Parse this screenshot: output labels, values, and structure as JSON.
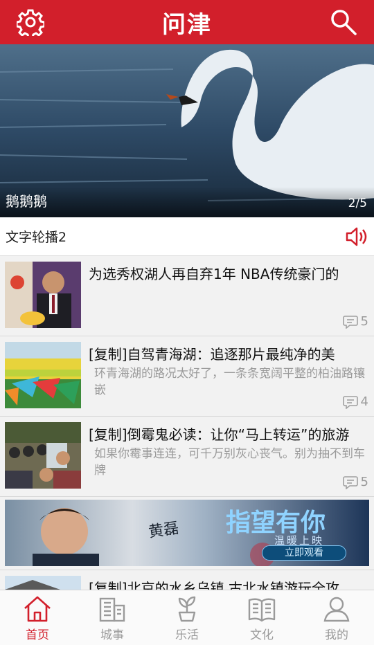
{
  "header": {
    "title": "问津",
    "settings_icon": "gear-icon",
    "search_icon": "search-icon",
    "bg_color": "#d21f2b"
  },
  "banner": {
    "caption": "鹅鹅鹅",
    "counter": "2/5"
  },
  "ticker": {
    "text": "文字轮播2",
    "icon": "speaker-icon"
  },
  "news": [
    {
      "headline": "为选秀权湖人再自弃1年 NBA传统豪门的",
      "summary": "",
      "comments": "5"
    },
    {
      "headline": "[复制]自驾青海湖：追逐那片最纯净的美",
      "summary": "环青海湖的路况太好了，一条条宽阔平整的柏油路镶嵌",
      "comments": "4"
    },
    {
      "headline": "[复制]倒霉鬼必读：让你“马上转运”的旅游",
      "summary": "如果你霉事连连，可千万别灰心丧气。别为抽不到车牌",
      "comments": "5"
    }
  ],
  "ad": {
    "title": "指望有你",
    "subtitle": "温暖上映",
    "button": "立即观看",
    "signature": "黄磊"
  },
  "news_after_ad": [
    {
      "headline": "[复制]北京的水乡乌镇 古北水镇游玩全攻"
    }
  ],
  "bottom_nav": [
    {
      "label": "首页",
      "icon": "home-icon",
      "active": true
    },
    {
      "label": "城事",
      "icon": "building-icon",
      "active": false
    },
    {
      "label": "乐活",
      "icon": "sprout-icon",
      "active": false
    },
    {
      "label": "文化",
      "icon": "book-icon",
      "active": false
    },
    {
      "label": "我的",
      "icon": "user-icon",
      "active": false
    }
  ]
}
